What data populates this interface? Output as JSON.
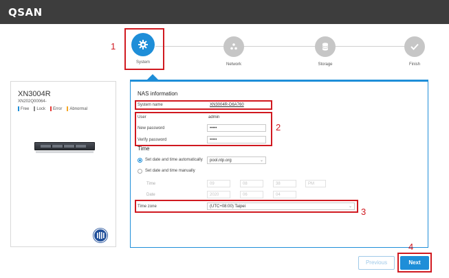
{
  "app": {
    "logo": "QSAN"
  },
  "wizard": {
    "steps": [
      {
        "label": "System",
        "icon": "gear-icon"
      },
      {
        "label": "Network",
        "icon": "network-icon"
      },
      {
        "label": "Storage",
        "icon": "database-icon"
      },
      {
        "label": "Finish",
        "icon": "check-icon"
      }
    ]
  },
  "annotations": [
    "1",
    "2",
    "3",
    "4"
  ],
  "device": {
    "name": "XN3004R",
    "serial": "XN202Q00064-",
    "legend": [
      {
        "label": "Free",
        "color": "#1e8ed8"
      },
      {
        "label": "Lock",
        "color": "#888888"
      },
      {
        "label": "Error",
        "color": "#e53935"
      },
      {
        "label": "Abnormal",
        "color": "#f5a623"
      }
    ]
  },
  "nas": {
    "title": "NAS information",
    "system_name_label": "System name",
    "system_name_value": "XN3004R-D6A760",
    "user_label": "User",
    "user_value": "admin",
    "new_password_label": "New password",
    "new_password_value": "•••••",
    "verify_password_label": "Verify password",
    "verify_password_value": "•••••"
  },
  "time": {
    "title": "Time",
    "auto_label": "Set date and time automatically",
    "ntp_server": "pool.ntp.org",
    "manual_label": "Set date and time manually",
    "time_label": "Time",
    "date_label": "Date",
    "time_fields": [
      "09",
      "08",
      "38",
      "PM"
    ],
    "date_fields": [
      "2020",
      "06",
      "04"
    ],
    "timezone_label": "Time zone",
    "timezone_value": "(UTC+08:00) Taipei"
  },
  "buttons": {
    "previous": "Previous",
    "next": "Next"
  },
  "colors": {
    "accent": "#1e8ed8",
    "annotation": "#d0181f",
    "topbar": "#3d3d3d"
  }
}
